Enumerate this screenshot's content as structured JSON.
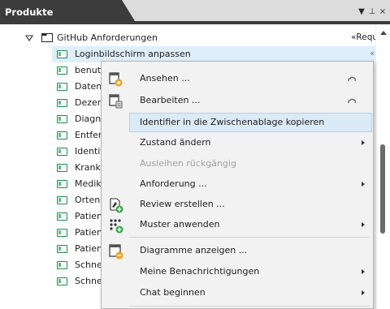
{
  "panel": {
    "title": "Produkte",
    "controls": [
      "▼",
      "⊥",
      "×"
    ]
  },
  "tree": {
    "root": {
      "label": "GitHub Anforderungen",
      "right_tag": "«Requ"
    },
    "items": [
      {
        "label": "Loginbildschirm anpassen",
        "right_tag": "«",
        "selected": true
      },
      {
        "label": "benutz"
      },
      {
        "label": "Datens"
      },
      {
        "label": "Dezent"
      },
      {
        "label": "Diagno"
      },
      {
        "label": "Entfern"
      },
      {
        "label": "Identifi"
      },
      {
        "label": "Kranke"
      },
      {
        "label": "Medika"
      },
      {
        "label": "Orten ("
      },
      {
        "label": "Patient"
      },
      {
        "label": "Patient"
      },
      {
        "label": "Patient"
      },
      {
        "label": "Schnel"
      },
      {
        "label": "Schnel"
      }
    ]
  },
  "context_menu": {
    "items": [
      {
        "label": "Ansehen ...",
        "icon": "view-doc-icon",
        "cloud": true
      },
      {
        "label": "Bearbeiten ...",
        "icon": "edit-doc-icon",
        "cloud": true
      },
      {
        "label": "Identifier in die Zwischenablage kopieren",
        "hover": true
      },
      {
        "label": "Zustand ändern",
        "submenu": true
      },
      {
        "label": "Ausleihen rückgängig",
        "disabled": true
      },
      {
        "label": "Anforderung ...",
        "submenu": true
      },
      {
        "label": "Review erstellen ...",
        "icon": "review-icon"
      },
      {
        "label": "Muster anwenden",
        "icon": "pattern-icon",
        "submenu": true
      },
      {
        "label": "Diagramme anzeigen ...",
        "icon": "diagram-icon"
      },
      {
        "label": "Meine Benachrichtigungen",
        "submenu": true
      },
      {
        "label": "Chat beginnen",
        "submenu": true
      }
    ]
  },
  "colors": {
    "header_dark": "#3c3c3c",
    "selection": "#dfeefb",
    "menu_hover": "#dbeaf7",
    "req_icon_green": "#1f8a4c"
  }
}
